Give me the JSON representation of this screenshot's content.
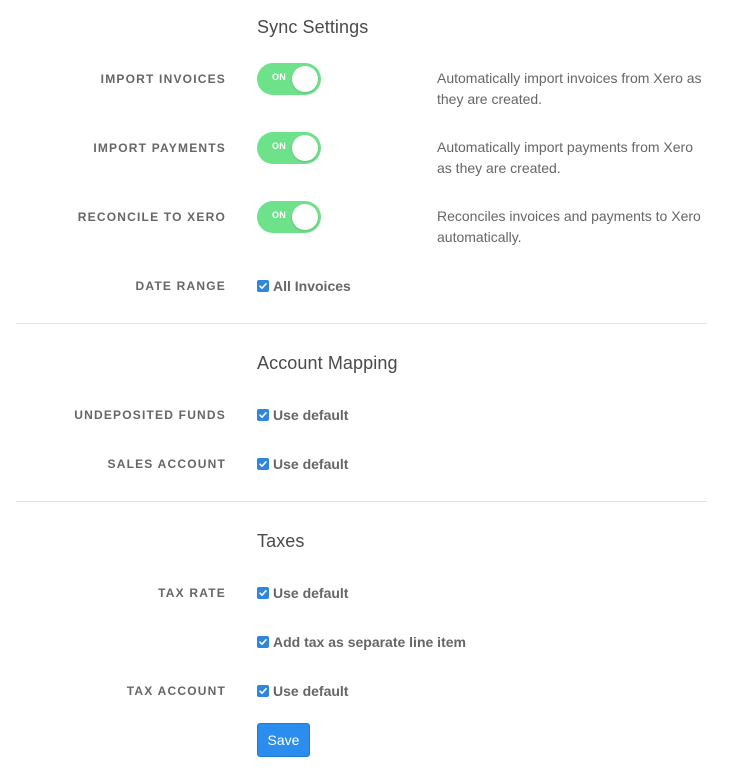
{
  "sync": {
    "title": "Sync Settings",
    "import_invoices": {
      "label": "IMPORT INVOICES",
      "toggle": "ON",
      "desc_line1": "Automatically import invoices from Xero as",
      "desc_line2": "they are created."
    },
    "import_payments": {
      "label": "IMPORT PAYMENTS",
      "toggle": "ON",
      "desc_line1": "Automatically import payments from Xero",
      "desc_line2": "as they are created."
    },
    "reconcile": {
      "label": "RECONCILE TO XERO",
      "toggle": "ON",
      "desc_line1": "Reconciles invoices and payments to Xero",
      "desc_line2": "automatically."
    },
    "date_range": {
      "label": "DATE RANGE",
      "option": "All Invoices"
    }
  },
  "mapping": {
    "title": "Account Mapping",
    "undeposited": {
      "label": "UNDEPOSITED FUNDS",
      "option": "Use default"
    },
    "sales": {
      "label": "SALES ACCOUNT",
      "option": "Use default"
    }
  },
  "taxes": {
    "title": "Taxes",
    "tax_rate": {
      "label": "TAX RATE",
      "option": "Use default"
    },
    "separate_line": {
      "option": "Add tax as separate line item"
    },
    "tax_account": {
      "label": "TAX ACCOUNT",
      "option": "Use default"
    }
  },
  "save_label": "Save",
  "colors": {
    "toggle_on": "#6ee28a",
    "checkbox": "#2e86de",
    "button": "#2b8ded"
  },
  "icons": {
    "checkbox": "checkmark-icon"
  }
}
